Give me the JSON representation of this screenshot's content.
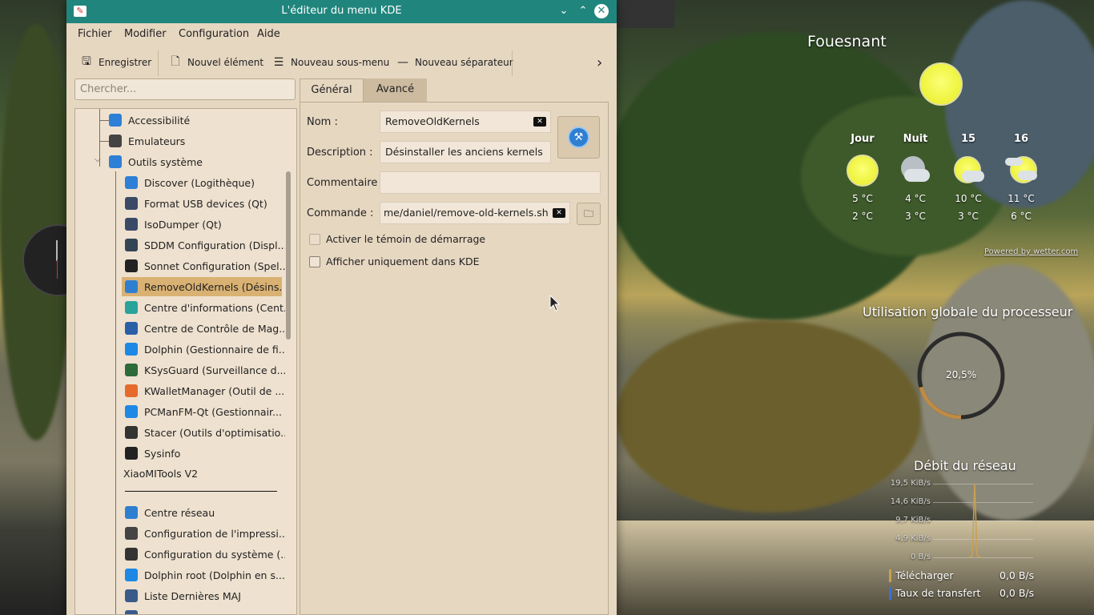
{
  "window": {
    "title": "L'éditeur du menu KDE",
    "app_icon": "kmenuedit-icon",
    "buttons": [
      "minimize",
      "maximize",
      "close"
    ]
  },
  "menubar": [
    "Fichier",
    "Modifier",
    "Configuration",
    "Aide"
  ],
  "toolbar": {
    "save_label": "Enregistrer",
    "new_item_label": "Nouvel élément",
    "new_submenu_label": "Nouveau sous-menu",
    "new_separator_label": "Nouveau séparateur",
    "more": "›"
  },
  "search": {
    "placeholder": "Chercher...",
    "value": ""
  },
  "tree": {
    "items": [
      {
        "label": "Accessibilité",
        "icon": "accessibility-icon",
        "color": "#2e7fd6"
      },
      {
        "label": "Emulateurs",
        "icon": "emulator-icon",
        "color": "#444444"
      },
      {
        "label": "Outils système",
        "icon": "system-tools-icon",
        "color": "#2e7fd6",
        "expanded": true
      },
      {
        "label": "Discover (Logithèque)",
        "icon": "discover-icon",
        "color": "#2e7fd6"
      },
      {
        "label": "Format USB devices (Qt)",
        "icon": "usb-icon",
        "color": "#3a4a66"
      },
      {
        "label": "IsoDumper (Qt)",
        "icon": "usb-icon",
        "color": "#3a4a66"
      },
      {
        "label": "SDDM Configuration (Displ...",
        "icon": "monitor-icon",
        "color": "#334455"
      },
      {
        "label": "Sonnet Configuration (Spel...",
        "icon": "spellcheck-icon",
        "color": "#222222"
      },
      {
        "label": "RemoveOldKernels (Désins...",
        "icon": "script-icon",
        "color": "#2f7fd1",
        "selected": true
      },
      {
        "label": "Centre d'informations (Cent...",
        "icon": "info-center-icon",
        "color": "#2aa39a"
      },
      {
        "label": "Centre de Contrôle de Mag...",
        "icon": "control-center-icon",
        "color": "#2a5fa8"
      },
      {
        "label": "Dolphin (Gestionnaire de fi...",
        "icon": "folder-icon",
        "color": "#1e88e5"
      },
      {
        "label": "KSysGuard (Surveillance d...",
        "icon": "ksysguard-icon",
        "color": "#2e6b3a"
      },
      {
        "label": "KWalletManager (Outil de ...",
        "icon": "wallet-icon",
        "color": "#e66a2c"
      },
      {
        "label": "PCManFM-Qt (Gestionnair...",
        "icon": "folder-icon",
        "color": "#1e88e5"
      },
      {
        "label": "Stacer (Outils d'optimisatio...",
        "icon": "settings-icon",
        "color": "#333333"
      },
      {
        "label": "Sysinfo",
        "icon": "menu-lines-icon",
        "color": "#222222"
      },
      {
        "label": "XiaoMITools V2",
        "icon": "",
        "color": ""
      },
      {
        "label": "Centre réseau",
        "icon": "network-icon",
        "color": "#2f7fd1"
      },
      {
        "label": "Configuration de l'impressi...",
        "icon": "printer-icon",
        "color": "#444444"
      },
      {
        "label": "Configuration du système (...",
        "icon": "settings-icon",
        "color": "#333333"
      },
      {
        "label": "Dolphin root (Dolphin en s...",
        "icon": "folder-icon",
        "color": "#1e88e5"
      },
      {
        "label": "Liste Dernières MAJ",
        "icon": "update-icon",
        "color": "#3a5a8a"
      },
      {
        "label": "",
        "icon": "update-icon",
        "color": "#3a5a8a"
      }
    ]
  },
  "tabs": [
    "Général",
    "Avancé"
  ],
  "form": {
    "name_label": "Nom :",
    "name_value": "RemoveOldKernels",
    "description_label": "Description :",
    "description_value": "Désinstaller les anciens kernels",
    "comment_label": "Commentaire :",
    "comment_value": "",
    "command_label": "Commande :",
    "command_value": "me/daniel/remove-old-kernels.sh",
    "checkbox_startup": "Activer le témoin de démarrage",
    "checkbox_kde_only": "Afficher uniquement dans KDE"
  },
  "weather": {
    "location": "Fouesnant",
    "days": [
      {
        "label": "Jour",
        "high": "5 °C",
        "low": "2 °C",
        "icon": "sun-icon"
      },
      {
        "label": "Nuit",
        "high": "4 °C",
        "low": "3 °C",
        "icon": "cloudy-night-icon"
      },
      {
        "label": "15",
        "high": "10 °C",
        "low": "3 °C",
        "icon": "sun-cloud-icon"
      },
      {
        "label": "16",
        "high": "11 °C",
        "low": "6 °C",
        "icon": "cloud-sun-icon"
      }
    ],
    "credit": "Powered by wetter.com"
  },
  "cpu": {
    "title": "Utilisation globale du processeur",
    "value": "20,5%",
    "fraction": 0.205
  },
  "network": {
    "title": "Débit du réseau",
    "ticks": [
      "19,5 KiB/s",
      "14,6 KiB/s",
      "9,7 KiB/s",
      "4,9 KiB/s",
      "0 B/s"
    ],
    "download_label": "Télécharger",
    "download_value": "0,0 B/s",
    "upload_label": "Taux de transfert",
    "upload_value": "0,0 B/s",
    "colors": {
      "download": "#c9a054",
      "upload": "#3d6fd6"
    }
  }
}
